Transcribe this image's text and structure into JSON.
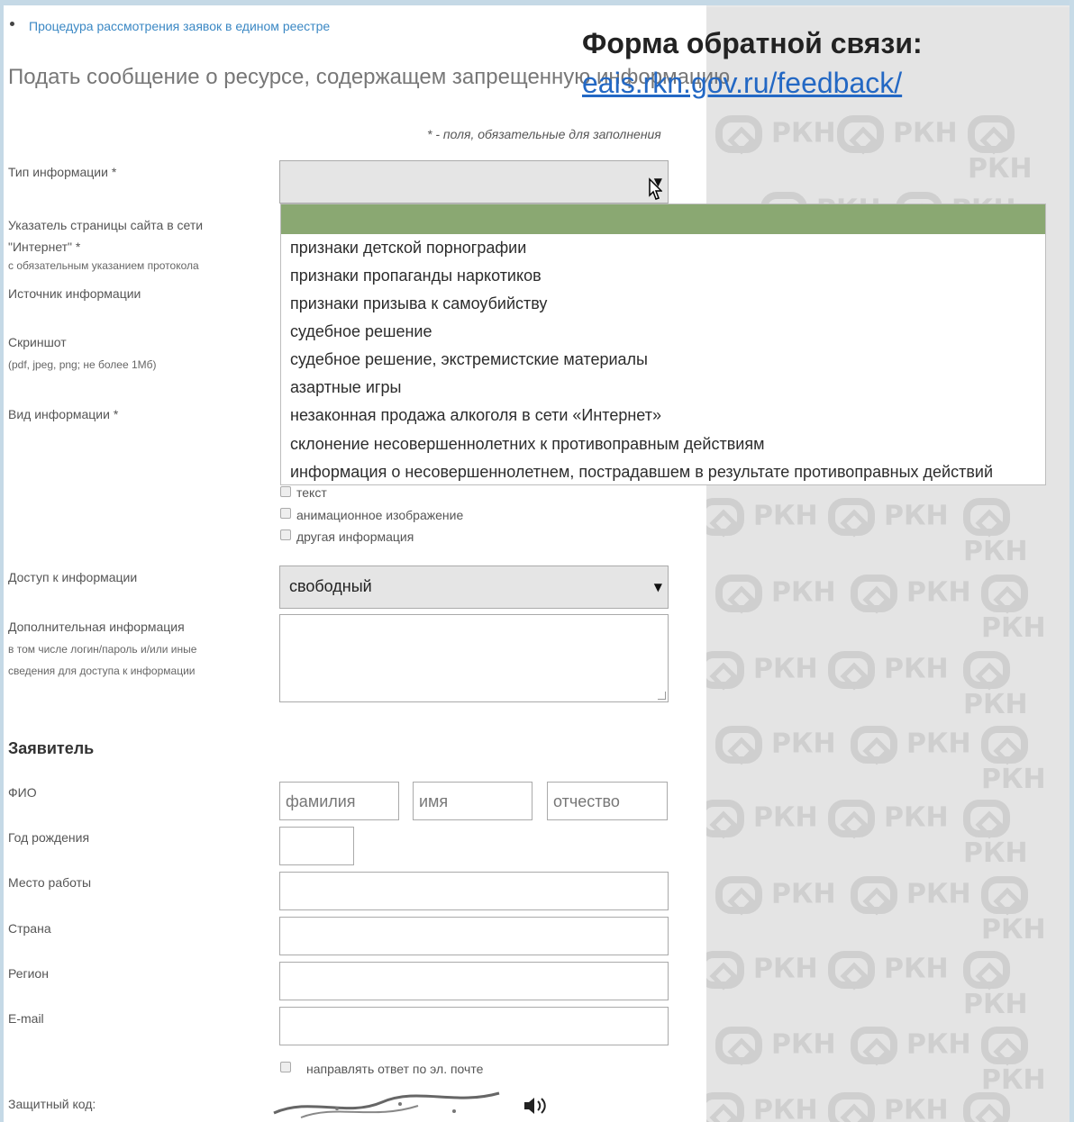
{
  "header": {
    "breadcrumb_link": "Процедура рассмотрения заявок в едином реестре",
    "page_title": "Подать сообщение о ресурсе, содержащем запрещенную информацию",
    "required_note": "* - поля, обязательные для заполнения",
    "overlay_title": "Форма обратной связи:",
    "overlay_link": "eais.rkn.gov.ru/feedback/"
  },
  "watermark": {
    "text": "РКН"
  },
  "form": {
    "info_type_label": "Тип информации *",
    "url_label": "Указатель страницы сайта в сети \"Интернет\" *",
    "url_hint": "с обязательным указанием протокола",
    "source_label": "Источник информации",
    "screenshot_label": "Скриншот",
    "screenshot_hint": "(pdf, jpeg, png; не более 1Мб)",
    "view_label": "Вид информации *",
    "view_options": [
      "текст",
      "анимационное изображение",
      "другая информация"
    ],
    "access_label": "Доступ к информации",
    "access_value": "свободный",
    "extra_label": "Дополнительная информация",
    "extra_hint_1": "в том числе логин/пароль и/или иные",
    "extra_hint_2": "сведения для доступа к информации",
    "applicant_heading": "Заявитель",
    "fio_label": "ФИО",
    "surname_placeholder": "фамилия",
    "name_placeholder": "имя",
    "patronymic_placeholder": "отчество",
    "birth_label": "Год рождения",
    "work_label": "Место работы",
    "country_label": "Страна",
    "region_label": "Регион",
    "email_label": "E-mail",
    "reply_checkbox_label": "направлять ответ по эл. почте",
    "captcha_label": "Защитный код:"
  },
  "dropdown": {
    "options": [
      "признаки детской порнографии",
      "признаки пропаганды наркотиков",
      "признаки призыва к самоубийству",
      "судебное решение",
      "судебное решение, экстремистские материалы",
      "азартные игры",
      "незаконная продажа алкоголя в сети «Интернет»",
      "склонение несовершеннолетних к противоправным действиям",
      "информация о несовершеннолетнем, пострадавшем в результате противоправных действий"
    ]
  }
}
